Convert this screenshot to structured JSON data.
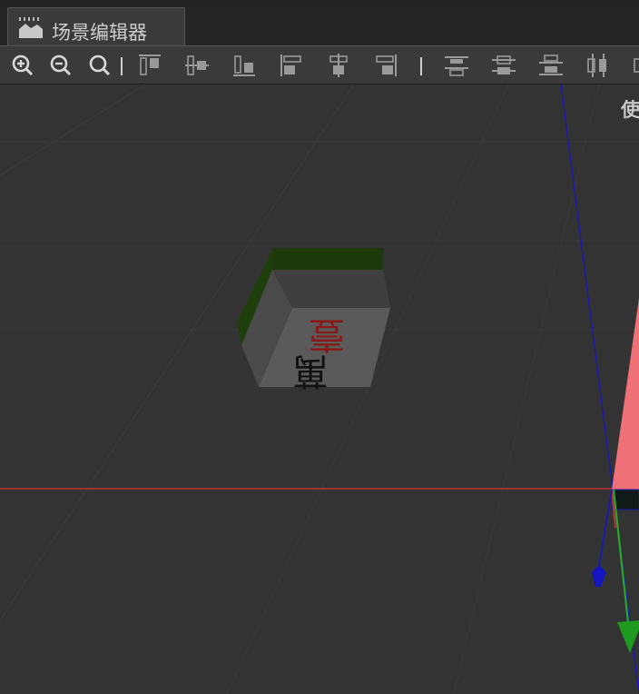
{
  "tab": {
    "title": "场景编辑器",
    "icon": "scene-icon"
  },
  "toolbar": {
    "zoom_buttons": [
      {
        "icon": "zoom-in-icon"
      },
      {
        "icon": "zoom-out-icon"
      },
      {
        "icon": "zoom-reset-icon"
      }
    ],
    "align_buttons": [
      {
        "icon": "align-top-icon"
      },
      {
        "icon": "align-vertical-center-icon"
      },
      {
        "icon": "align-bottom-icon"
      },
      {
        "icon": "align-left-icon"
      },
      {
        "icon": "align-horizontal-center-icon"
      },
      {
        "icon": "align-right-icon"
      }
    ],
    "distribute_buttons": [
      {
        "icon": "distribute-top-icon"
      },
      {
        "icon": "distribute-vertical-center-icon"
      },
      {
        "icon": "distribute-bottom-icon"
      },
      {
        "icon": "distribute-left-icon"
      },
      {
        "icon": "distribute-horizontal-icon"
      }
    ]
  },
  "viewport": {
    "corner_text": "使",
    "tile_characters": {
      "top": "壹",
      "bottom": "萬"
    }
  },
  "colors": {
    "viewport_bg": "#333333",
    "tile_back": "#1e3d0c",
    "tile_face": "#d8d8d8",
    "axis_x": "#b8323a",
    "axis_y": "#2aa82a",
    "axis_z": "#1a1ab0",
    "camera_frustum": "#f07078"
  }
}
